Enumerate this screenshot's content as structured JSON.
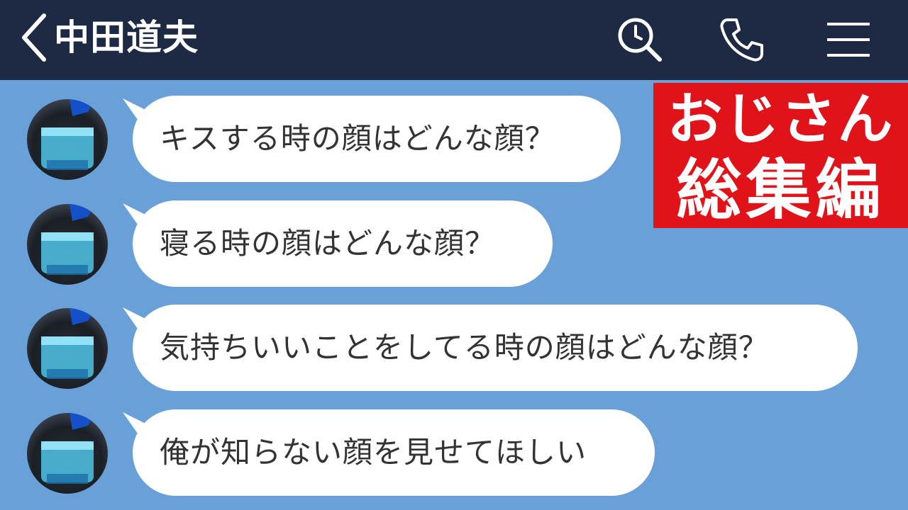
{
  "header": {
    "contact_name": "中田道夫",
    "icons": {
      "back": "chevron-left-icon",
      "search": "search-icon",
      "call": "phone-icon",
      "menu": "menu-icon"
    }
  },
  "badge": {
    "line1": "おじさん",
    "line2": "総集編",
    "color": "#e0131a"
  },
  "messages": [
    {
      "text": "キスする時の顔はどんな顔？"
    },
    {
      "text": "寝る時の顔はどんな顔？"
    },
    {
      "text": "気持ちいいことをしてる時の顔はどんな顔？"
    },
    {
      "text": "俺が知らない顔を見せてほしい"
    }
  ],
  "colors": {
    "header_bg": "#1e2a44",
    "chat_bg": "#6aa0d8",
    "bubble": "#ffffff"
  }
}
